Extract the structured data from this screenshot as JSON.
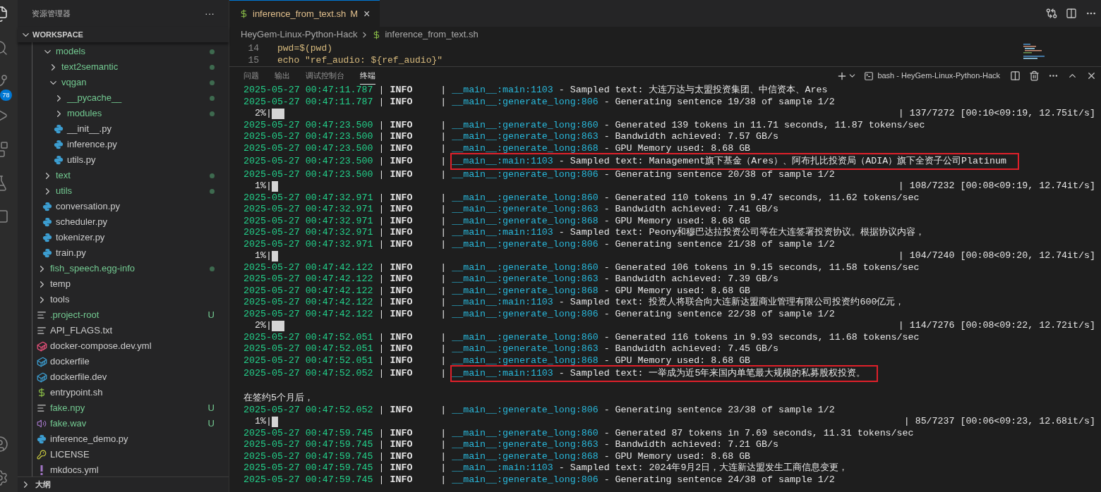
{
  "activity_bar": [
    {
      "kind": "explorer",
      "selected": true
    },
    {
      "kind": "search",
      "selected": false
    },
    {
      "kind": "source-control",
      "selected": false,
      "badge": "78"
    },
    {
      "kind": "run",
      "selected": false
    },
    {
      "kind": "extensions",
      "selected": false
    },
    {
      "kind": "testing",
      "selected": false
    },
    {
      "kind": "chat",
      "selected": false
    },
    {
      "kind": "account",
      "selected": false
    },
    {
      "kind": "manage",
      "selected": false
    }
  ],
  "explorer": {
    "title": "资源管理器",
    "more": "···",
    "section": "WORKSPACE",
    "outline": "大纲",
    "tree": [
      {
        "children": [
          {
            "name": "models",
            "kind": "folder",
            "expanded": true,
            "dot": true,
            "children": [
              {
                "name": "text2semantic",
                "kind": "folder",
                "expanded": false,
                "dot": true
              },
              {
                "name": "vqgan",
                "kind": "folder",
                "expanded": true,
                "dot": true,
                "children": [
                  {
                    "name": "__pycache__",
                    "kind": "folder",
                    "expanded": false,
                    "dot": true
                  },
                  {
                    "name": "modules",
                    "kind": "folder",
                    "expanded": false,
                    "dot": true
                  },
                  {
                    "name": "__init__.py",
                    "kind": "python"
                  },
                  {
                    "name": "inference.py",
                    "kind": "python"
                  },
                  {
                    "name": "utils.py",
                    "kind": "python"
                  }
                ]
              }
            ]
          },
          {
            "name": "text",
            "kind": "folder",
            "expanded": false,
            "dot": true
          },
          {
            "name": "utils",
            "kind": "folder",
            "expanded": false,
            "dot": true
          },
          {
            "name": "conversation.py",
            "kind": "python"
          },
          {
            "name": "scheduler.py",
            "kind": "python"
          },
          {
            "name": "tokenizer.py",
            "kind": "python"
          },
          {
            "name": "train.py",
            "kind": "python"
          }
        ]
      },
      {
        "name": "fish_speech.egg-info",
        "kind": "folder",
        "expanded": false,
        "dot": true
      },
      {
        "name": "temp",
        "kind": "folder",
        "expanded": false
      },
      {
        "name": "tools",
        "kind": "folder",
        "expanded": false
      },
      {
        "name": ".project-root",
        "kind": "lines",
        "badge": "U"
      },
      {
        "name": "API_FLAGS.txt",
        "kind": "lines"
      },
      {
        "name": "docker-compose.dev.yml",
        "kind": "compose"
      },
      {
        "name": "dockerfile",
        "kind": "docker"
      },
      {
        "name": "dockerfile.dev",
        "kind": "docker"
      },
      {
        "name": "entrypoint.sh",
        "kind": "shell"
      },
      {
        "name": "fake.npy",
        "kind": "lines",
        "badge": "U"
      },
      {
        "name": "fake.wav",
        "kind": "audio",
        "badge": "U"
      },
      {
        "name": "inference_demo.py",
        "kind": "python"
      },
      {
        "name": "LICENSE",
        "kind": "license"
      },
      {
        "name": "mkdocs.yml",
        "kind": "yaml"
      }
    ]
  },
  "editor": {
    "tabs": [
      {
        "label": "inference_from_text.sh",
        "badge": "M",
        "close": "×",
        "selected": true
      }
    ],
    "breadcrumb": [
      {
        "label": "HeyGem-Linux-Python-Hack",
        "kind": "folder"
      },
      {
        "label": "inference_from_text.sh",
        "kind": "shell"
      }
    ],
    "code": [
      {
        "number": "14",
        "text": "pwd=$(pwd)"
      },
      {
        "number": "15",
        "text": "echo \"ref_audio: ${ref_audio}\""
      }
    ]
  },
  "panel": {
    "tabs": [
      {
        "label": "问题",
        "selected": false
      },
      {
        "label": "输出",
        "selected": false
      },
      {
        "label": "调试控制台",
        "selected": false
      },
      {
        "label": "终端",
        "selected": true
      }
    ],
    "terminal_name": "bash - HeyGem-Linux-Python-Hack",
    "lines": [
      {
        "kind": "log",
        "highlighted": false,
        "parts": [
          "2025-05-27 00:47:11.787",
          "|",
          "INFO",
          "|",
          "__main__:main:1103",
          "-",
          "Sampled text: 大连万达与太盟投资集团、中信资本、Ares"
        ]
      },
      {
        "kind": "log",
        "highlighted": false,
        "parts": [
          "2025-05-27 00:47:11.787",
          "|",
          "INFO",
          "|",
          "__main__:generate_long:806",
          "-",
          "Generating sentence 19/38 of sample 1/2"
        ]
      },
      {
        "kind": "progress",
        "percent": "2%|",
        "level": 0.02,
        "stats": "| 137/7272 [00:10<09:19, 12.75it/s]"
      },
      {
        "kind": "log",
        "highlighted": false,
        "parts": [
          "2025-05-27 00:47:23.500",
          "|",
          "INFO",
          "|",
          "__main__:generate_long:860",
          "-",
          "Generated 139 tokens in 11.71 seconds, 11.87 tokens/sec"
        ]
      },
      {
        "kind": "log",
        "highlighted": false,
        "parts": [
          "2025-05-27 00:47:23.500",
          "|",
          "INFO",
          "|",
          "__main__:generate_long:863",
          "-",
          "Bandwidth achieved: 7.57 GB/s"
        ]
      },
      {
        "kind": "log",
        "highlighted": false,
        "parts": [
          "2025-05-27 00:47:23.500",
          "|",
          "INFO",
          "|",
          "__main__:generate_long:868",
          "-",
          "GPU Memory used: 8.68 GB"
        ]
      },
      {
        "kind": "log",
        "highlighted": true,
        "parts": [
          "2025-05-27 00:47:23.500",
          "|",
          "INFO",
          "|",
          "__main__:main:1103",
          "-",
          "Sampled text: Management旗下基金（Ares）、阿布扎比投资局（ADIA）旗下全资子公司Platinum"
        ]
      },
      {
        "kind": "log",
        "highlighted": false,
        "parts": [
          "2025-05-27 00:47:23.500",
          "|",
          "INFO",
          "|",
          "__main__:generate_long:806",
          "-",
          "Generating sentence 20/38 of sample 1/2"
        ]
      },
      {
        "kind": "progress",
        "percent": "1%|",
        "level": 0.01,
        "stats": "| 108/7232 [00:08<09:19, 12.74it/s]"
      },
      {
        "kind": "log",
        "highlighted": false,
        "parts": [
          "2025-05-27 00:47:32.971",
          "|",
          "INFO",
          "|",
          "__main__:generate_long:860",
          "-",
          "Generated 110 tokens in 9.47 seconds, 11.62 tokens/sec"
        ]
      },
      {
        "kind": "log",
        "highlighted": false,
        "parts": [
          "2025-05-27 00:47:32.971",
          "|",
          "INFO",
          "|",
          "__main__:generate_long:863",
          "-",
          "Bandwidth achieved: 7.41 GB/s"
        ]
      },
      {
        "kind": "log",
        "highlighted": false,
        "parts": [
          "2025-05-27 00:47:32.971",
          "|",
          "INFO",
          "|",
          "__main__:generate_long:868",
          "-",
          "GPU Memory used: 8.68 GB"
        ]
      },
      {
        "kind": "log",
        "highlighted": false,
        "parts": [
          "2025-05-27 00:47:32.971",
          "|",
          "INFO",
          "|",
          "__main__:main:1103",
          "-",
          "Sampled text: Peony和穆巴达拉投资公司等在大连签署投资协议。根据协议内容，"
        ]
      },
      {
        "kind": "log",
        "highlighted": false,
        "parts": [
          "2025-05-27 00:47:32.971",
          "|",
          "INFO",
          "|",
          "__main__:generate_long:806",
          "-",
          "Generating sentence 21/38 of sample 1/2"
        ]
      },
      {
        "kind": "progress",
        "percent": "1%|",
        "level": 0.01,
        "stats": "| 104/7240 [00:08<09:20, 12.74it/s]"
      },
      {
        "kind": "log",
        "highlighted": false,
        "parts": [
          "2025-05-27 00:47:42.122",
          "|",
          "INFO",
          "|",
          "__main__:generate_long:860",
          "-",
          "Generated 106 tokens in 9.15 seconds, 11.58 tokens/sec"
        ]
      },
      {
        "kind": "log",
        "highlighted": false,
        "parts": [
          "2025-05-27 00:47:42.122",
          "|",
          "INFO",
          "|",
          "__main__:generate_long:863",
          "-",
          "Bandwidth achieved: 7.39 GB/s"
        ]
      },
      {
        "kind": "log",
        "highlighted": false,
        "parts": [
          "2025-05-27 00:47:42.122",
          "|",
          "INFO",
          "|",
          "__main__:generate_long:868",
          "-",
          "GPU Memory used: 8.68 GB"
        ]
      },
      {
        "kind": "log",
        "highlighted": false,
        "parts": [
          "2025-05-27 00:47:42.122",
          "|",
          "INFO",
          "|",
          "__main__:main:1103",
          "-",
          "Sampled text: 投资人将联合向大连新达盟商业管理有限公司投资约600亿元，"
        ]
      },
      {
        "kind": "log",
        "highlighted": false,
        "parts": [
          "2025-05-27 00:47:42.122",
          "|",
          "INFO",
          "|",
          "__main__:generate_long:806",
          "-",
          "Generating sentence 22/38 of sample 1/2"
        ]
      },
      {
        "kind": "progress",
        "percent": "2%|",
        "level": 0.02,
        "stats": "| 114/7276 [00:08<09:22, 12.72it/s]"
      },
      {
        "kind": "log",
        "highlighted": false,
        "parts": [
          "2025-05-27 00:47:52.051",
          "|",
          "INFO",
          "|",
          "__main__:generate_long:860",
          "-",
          "Generated 116 tokens in 9.93 seconds, 11.68 tokens/sec"
        ]
      },
      {
        "kind": "log",
        "highlighted": false,
        "parts": [
          "2025-05-27 00:47:52.051",
          "|",
          "INFO",
          "|",
          "__main__:generate_long:863",
          "-",
          "Bandwidth achieved: 7.45 GB/s"
        ]
      },
      {
        "kind": "log",
        "highlighted": false,
        "parts": [
          "2025-05-27 00:47:52.051",
          "|",
          "INFO",
          "|",
          "__main__:generate_long:868",
          "-",
          "GPU Memory used: 8.68 GB"
        ]
      },
      {
        "kind": "log",
        "highlighted": true,
        "parts": [
          "2025-05-27 00:47:52.052",
          "|",
          "INFO",
          "|",
          "__main__:main:1103",
          "-",
          "Sampled text: 一举成为近5年来国内单笔最大规模的私募股权投资。"
        ]
      },
      {
        "kind": "blank"
      },
      {
        "kind": "plain",
        "text": "在签约5个月后，"
      },
      {
        "kind": "log",
        "highlighted": false,
        "parts": [
          "2025-05-27 00:47:52.052",
          "|",
          "INFO",
          "|",
          "__main__:generate_long:806",
          "-",
          "Generating sentence 23/38 of sample 1/2"
        ]
      },
      {
        "kind": "progress",
        "percent": "1%|",
        "level": 0.01,
        "stats": "| 85/7237 [00:06<09:23, 12.68it/s]"
      },
      {
        "kind": "log",
        "highlighted": false,
        "parts": [
          "2025-05-27 00:47:59.745",
          "|",
          "INFO",
          "|",
          "__main__:generate_long:860",
          "-",
          "Generated 87 tokens in 7.69 seconds, 11.31 tokens/sec"
        ]
      },
      {
        "kind": "log",
        "highlighted": false,
        "parts": [
          "2025-05-27 00:47:59.745",
          "|",
          "INFO",
          "|",
          "__main__:generate_long:863",
          "-",
          "Bandwidth achieved: 7.21 GB/s"
        ]
      },
      {
        "kind": "log",
        "highlighted": false,
        "parts": [
          "2025-05-27 00:47:59.745",
          "|",
          "INFO",
          "|",
          "__main__:generate_long:868",
          "-",
          "GPU Memory used: 8.68 GB"
        ]
      },
      {
        "kind": "log",
        "highlighted": false,
        "parts": [
          "2025-05-27 00:47:59.745",
          "|",
          "INFO",
          "|",
          "__main__:main:1103",
          "-",
          "Sampled text: 2024年9月2日，大连新达盟发生工商信息变更，"
        ]
      },
      {
        "kind": "log",
        "highlighted": false,
        "parts": [
          "2025-05-27 00:47:59.745",
          "|",
          "INFO",
          "|",
          "__main__:generate_long:806",
          "-",
          "Generating sentence 24/38 of sample 1/2"
        ]
      }
    ]
  }
}
